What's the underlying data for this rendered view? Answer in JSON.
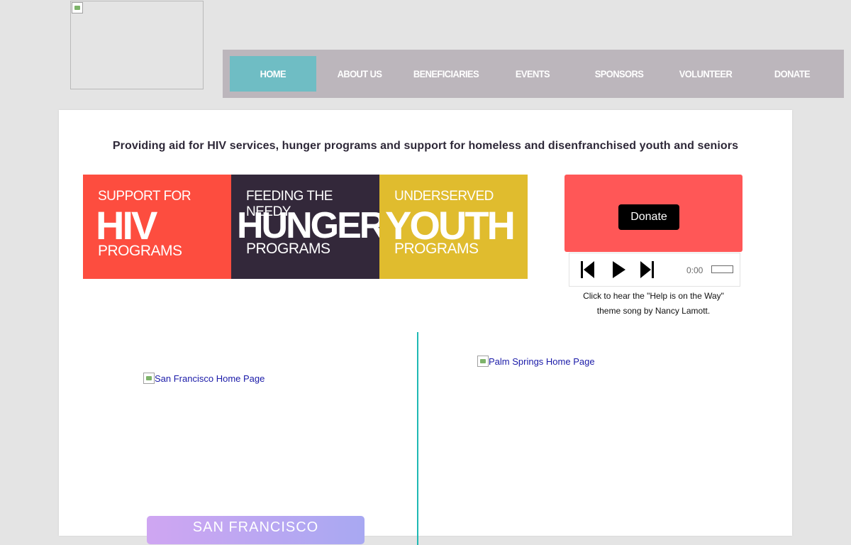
{
  "header": {
    "logo_icon": "broken-image-icon"
  },
  "nav": {
    "items": [
      {
        "label": "HOME",
        "active": true
      },
      {
        "label": "ABOUT US"
      },
      {
        "label": "BENEFICIARIES"
      },
      {
        "label": "EVENTS"
      },
      {
        "label": "SPONSORS"
      },
      {
        "label": "VOLUNTEER"
      },
      {
        "label": "DONATE"
      }
    ]
  },
  "main": {
    "tagline": "Providing aid for HIV services, hunger programs and support for homeless and disenfranchised youth and seniors",
    "banner": {
      "tiles": [
        {
          "pre": "SUPPORT FOR",
          "big": "HIV",
          "post": "PROGRAMS",
          "color": "#fd4d3f"
        },
        {
          "pre": "FEEDING THE NEEDY",
          "big": "HUNGER",
          "post": "PROGRAMS",
          "color": "#33283a"
        },
        {
          "pre": "UNDERSERVED",
          "big": "YOUTH",
          "post": "PROGRAMS",
          "color": "#e0bc2e"
        }
      ]
    },
    "donate": {
      "button_label": "Donate",
      "panel_color": "#ff5757"
    },
    "player": {
      "time": "0:00",
      "icons": [
        "skip-back-icon",
        "play-icon",
        "skip-forward-icon"
      ]
    },
    "caption_line1": "Click to hear the \"Help is on the Way\"",
    "caption_line2": "theme song by Nancy Lamott.",
    "links": {
      "sf_alt": "San Francisco Home Page",
      "ps_alt": "Palm Springs Home Page",
      "sf_button": "SAN FRANCISCO"
    },
    "accent_color": "#1fb9b4"
  }
}
